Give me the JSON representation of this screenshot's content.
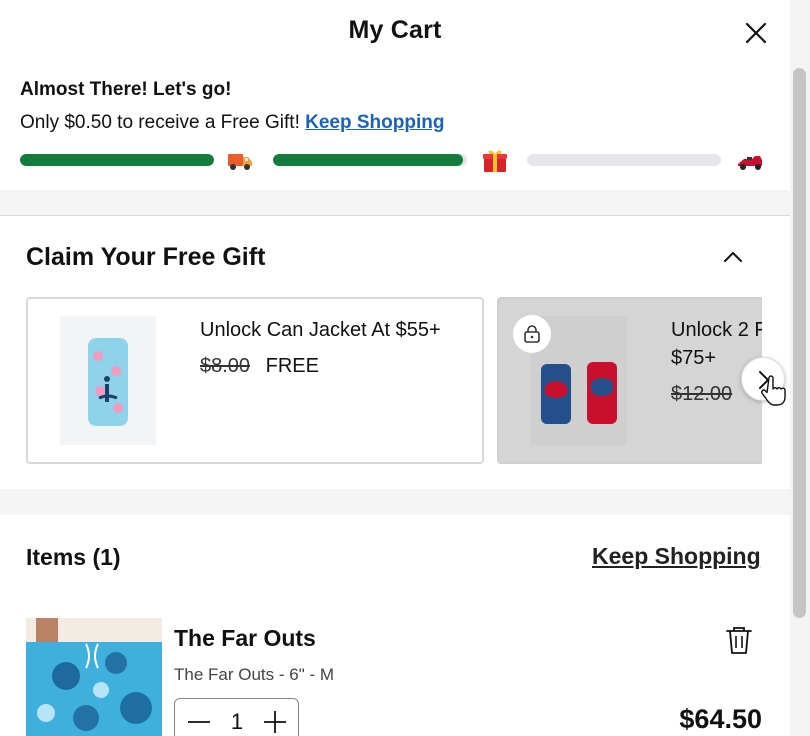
{
  "cart": {
    "title": "My Cart",
    "close_icon": "close-icon"
  },
  "progress": {
    "heading": "Almost There! Let's go!",
    "message": "Only $0.50 to receive a Free Gift!",
    "link": "Keep Shopping",
    "fill_color": "#127c3c",
    "track_color": "#e4e6ea",
    "tiers": [
      {
        "icon": "delivery-truck-icon",
        "fill_percent": 100
      },
      {
        "icon": "gift-icon",
        "fill_percent": 98
      },
      {
        "icon": "race-car-icon",
        "fill_percent": 0
      }
    ]
  },
  "gifts": {
    "title": "Claim Your Free Gift",
    "toggle_icon": "chevron-up-icon",
    "next_icon": "chevron-right-icon",
    "items": [
      {
        "name": "Unlock Can Jacket At $55+",
        "original_price": "$8.00",
        "price": "FREE",
        "locked": false
      },
      {
        "name": "Unlock 2 F\n$75+",
        "original_price": "$12.00",
        "price": "",
        "locked": true,
        "lock_icon": "lock-icon"
      }
    ]
  },
  "items": {
    "title": "Items (1)",
    "link": "Keep Shopping",
    "list": [
      {
        "name": "The Far Outs",
        "variant": "The Far Outs - 6\" - M",
        "quantity": "1",
        "price": "$64.50",
        "delete_icon": "trash-icon"
      }
    ]
  }
}
